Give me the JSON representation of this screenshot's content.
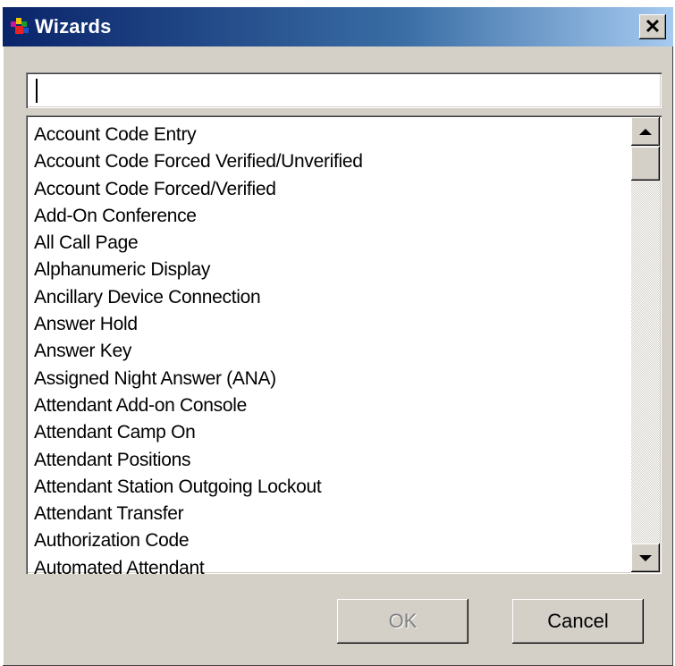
{
  "window": {
    "title": "Wizards",
    "close_glyph": "✕"
  },
  "filter": {
    "value": "",
    "placeholder": ""
  },
  "list": {
    "items": [
      "Account Code Entry",
      "Account Code Forced Verified/Unverified",
      "Account Code Forced/Verified",
      "Add-On Conference",
      "All Call Page",
      "Alphanumeric Display",
      "Ancillary Device Connection",
      "Answer Hold",
      "Answer Key",
      "Assigned Night Answer (ANA)",
      "Attendant Add-on Console",
      "Attendant Camp On",
      "Attendant Positions",
      "Attendant Station Outgoing Lockout",
      "Attendant Transfer",
      "Authorization Code",
      "Automated Attendant"
    ]
  },
  "buttons": {
    "ok": "OK",
    "cancel": "Cancel",
    "ok_enabled": false
  },
  "icons": [
    "wizard-app-icon",
    "close-icon",
    "scroll-up-icon",
    "scroll-down-icon"
  ],
  "colors": {
    "titlebar_start": "#0a246a",
    "titlebar_end": "#a6caf0",
    "face": "#d4d0c8"
  }
}
